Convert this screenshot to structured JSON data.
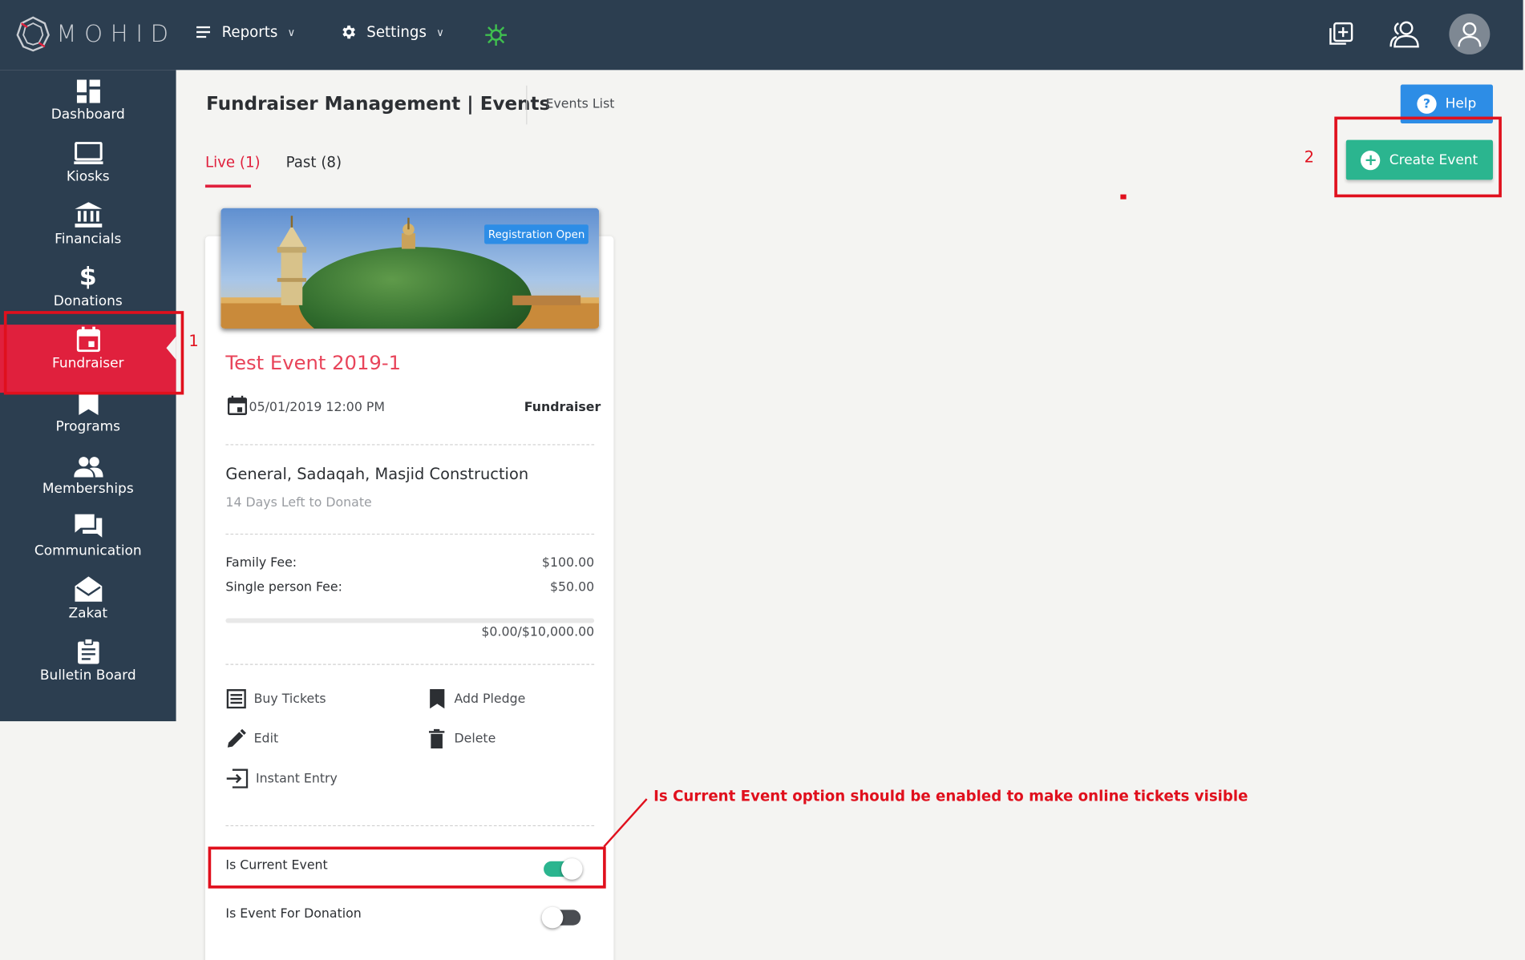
{
  "header": {
    "logo_text": "MOHID",
    "nav": [
      {
        "label": "Reports"
      },
      {
        "label": "Settings"
      }
    ]
  },
  "sidebar": {
    "items": [
      {
        "label": "Dashboard",
        "icon": "dashboard-icon"
      },
      {
        "label": "Kiosks",
        "icon": "kiosk-icon"
      },
      {
        "label": "Financials",
        "icon": "bank-icon"
      },
      {
        "label": "Donations",
        "icon": "dollar-icon"
      },
      {
        "label": "Fundraiser",
        "icon": "calendar-icon",
        "active": true
      },
      {
        "label": "Programs",
        "icon": "bookmark-icon"
      },
      {
        "label": "Memberships",
        "icon": "people-icon"
      },
      {
        "label": "Communication",
        "icon": "chat-icon"
      },
      {
        "label": "Zakat",
        "icon": "envelope-icon"
      },
      {
        "label": "Bulletin Board",
        "icon": "clipboard-icon"
      }
    ]
  },
  "page": {
    "title": "Fundraiser Management | Events",
    "breadcrumb": "Events List",
    "tabs": [
      {
        "label": "Live (1)",
        "active": true
      },
      {
        "label": "Past (8)"
      }
    ],
    "help_label": "Help",
    "create_label": "Create Event"
  },
  "event": {
    "badge": "Registration Open",
    "title": "Test Event 2019-1",
    "date": "05/01/2019 12:00 PM",
    "type": "Fundraiser",
    "purposes": "General, Sadaqah, Masjid Construction",
    "days_left": "14 Days Left to Donate",
    "fees": [
      {
        "label": "Family Fee:",
        "value": "$100.00"
      },
      {
        "label": "Single person Fee:",
        "value": "$50.00"
      }
    ],
    "raised": "$0.00/$10,000.00",
    "progress_fraction": 0,
    "actions": {
      "buy_tickets": "Buy Tickets",
      "add_pledge": "Add Pledge",
      "edit": "Edit",
      "delete": "Delete",
      "instant_entry": "Instant Entry"
    },
    "toggles": [
      {
        "label": "Is Current Event",
        "on": true
      },
      {
        "label": "Is Event For Donation",
        "on": false
      }
    ]
  },
  "annotations": {
    "marker_1": "1",
    "marker_2": "2",
    "note": "Is Current Event option should be enabled to make online tickets visible"
  },
  "colors": {
    "nav_bg": "#2c3e50",
    "accent_red": "#e0203d",
    "accent_green": "#2bb58f",
    "accent_blue": "#2d8de6",
    "annotation_red": "#e0101d"
  }
}
